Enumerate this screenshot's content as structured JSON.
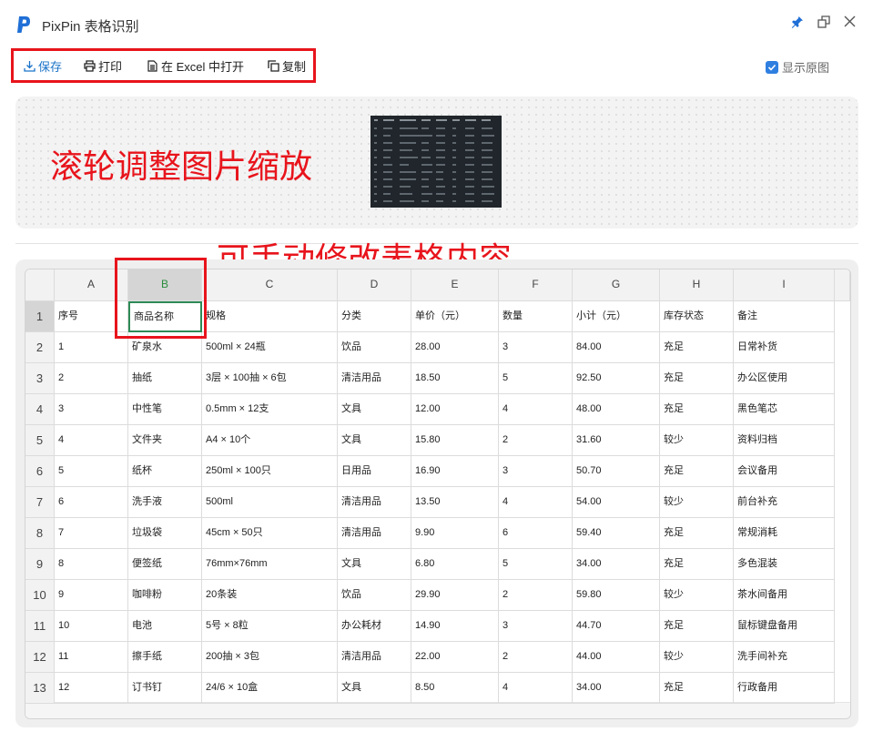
{
  "window": {
    "title": "PixPin 表格识别",
    "controls": {
      "pin": "pin-icon",
      "restore": "restore-icon",
      "close": "close-icon"
    }
  },
  "toolbar": {
    "save": "保存",
    "print": "打印",
    "open_excel": "在 Excel 中打开",
    "copy": "复制",
    "show_original": "显示原图",
    "show_original_checked": true
  },
  "annotations": {
    "zoom_hint": "滚轮调整图片缩放",
    "edit_hint": "可手动修改表格内容"
  },
  "colors": {
    "accent": "#2f7fe0",
    "annotation": "#e8141c",
    "selected_col": "#2a8c3c"
  },
  "sheet": {
    "columns": [
      "A",
      "B",
      "C",
      "D",
      "E",
      "F",
      "G",
      "H",
      "I"
    ],
    "selected_column": "B",
    "selected_row": "1",
    "rows": [
      {
        "n": "1",
        "cells": [
          "序号",
          "商品名称",
          "规格",
          "分类",
          "单价（元）",
          "数量",
          "小计（元）",
          "库存状态",
          "备注"
        ]
      },
      {
        "n": "2",
        "cells": [
          "1",
          "矿泉水",
          "500ml × 24瓶",
          "饮品",
          "28.00",
          "3",
          "84.00",
          "充足",
          "日常补货"
        ]
      },
      {
        "n": "3",
        "cells": [
          "2",
          "抽纸",
          "3层 × 100抽 × 6包",
          "清洁用品",
          "18.50",
          "5",
          "92.50",
          "充足",
          "办公区使用"
        ]
      },
      {
        "n": "4",
        "cells": [
          "3",
          "中性笔",
          "0.5mm × 12支",
          "文具",
          "12.00",
          "4",
          "48.00",
          "充足",
          "黑色笔芯"
        ]
      },
      {
        "n": "5",
        "cells": [
          "4",
          "文件夹",
          "A4 × 10个",
          "文具",
          "15.80",
          "2",
          "31.60",
          "较少",
          "资料归档"
        ]
      },
      {
        "n": "6",
        "cells": [
          "5",
          "纸杯",
          "250ml × 100只",
          "日用品",
          "16.90",
          "3",
          "50.70",
          "充足",
          "会议备用"
        ]
      },
      {
        "n": "7",
        "cells": [
          "6",
          "洗手液",
          "500ml",
          "清洁用品",
          "13.50",
          "4",
          "54.00",
          "较少",
          "前台补充"
        ]
      },
      {
        "n": "8",
        "cells": [
          "7",
          "垃圾袋",
          "45cm × 50只",
          "清洁用品",
          "9.90",
          "6",
          "59.40",
          "充足",
          "常规消耗"
        ]
      },
      {
        "n": "9",
        "cells": [
          "8",
          "便签纸",
          "76mm×76mm",
          "文具",
          "6.80",
          "5",
          "34.00",
          "充足",
          "多色混装"
        ]
      },
      {
        "n": "10",
        "cells": [
          "9",
          "咖啡粉",
          "20条装",
          "饮品",
          "29.90",
          "2",
          "59.80",
          "较少",
          "茶水间备用"
        ]
      },
      {
        "n": "11",
        "cells": [
          "10",
          "电池",
          "5号 × 8粒",
          "办公耗材",
          "14.90",
          "3",
          "44.70",
          "充足",
          "鼠标键盘备用"
        ]
      },
      {
        "n": "12",
        "cells": [
          "11",
          "擦手纸",
          "200抽 × 3包",
          "清洁用品",
          "22.00",
          "2",
          "44.00",
          "较少",
          "洗手间补充"
        ]
      },
      {
        "n": "13",
        "cells": [
          "12",
          "订书钉",
          "24/6 × 10盒",
          "文具",
          "8.50",
          "4",
          "34.00",
          "充足",
          "行政备用"
        ]
      }
    ]
  }
}
